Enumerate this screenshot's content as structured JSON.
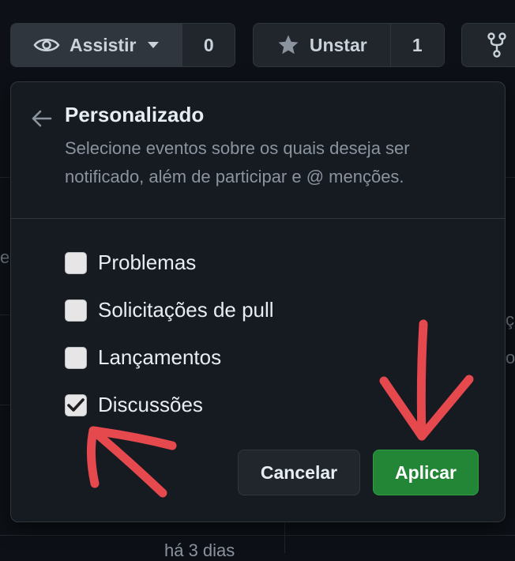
{
  "toolbar": {
    "watch_label": "Assistir",
    "watch_count": "0",
    "star_label": "Unstar",
    "star_count": "1"
  },
  "background": {
    "frag_left": "ei",
    "frag_right_1": "ç",
    "frag_right_2": "o.",
    "bottom_text": "há 3 dias"
  },
  "popover": {
    "title": "Personalizado",
    "description": "Selecione eventos sobre os quais deseja ser notificado, além de participar e @ menções.",
    "options": [
      {
        "label": "Problemas",
        "checked": false
      },
      {
        "label": "Solicitações de pull",
        "checked": false
      },
      {
        "label": "Lançamentos",
        "checked": false
      },
      {
        "label": "Discussões",
        "checked": true
      }
    ],
    "cancel_label": "Cancelar",
    "apply_label": "Aplicar"
  },
  "colors": {
    "apply_button": "#238636",
    "annotation_arrow": "#e5484d",
    "popover_bg": "#161b22",
    "page_bg": "#0d1117"
  },
  "icons": [
    "eye-icon",
    "caret-down-icon",
    "star-icon",
    "fork-icon",
    "arrow-left-icon",
    "check-icon"
  ]
}
